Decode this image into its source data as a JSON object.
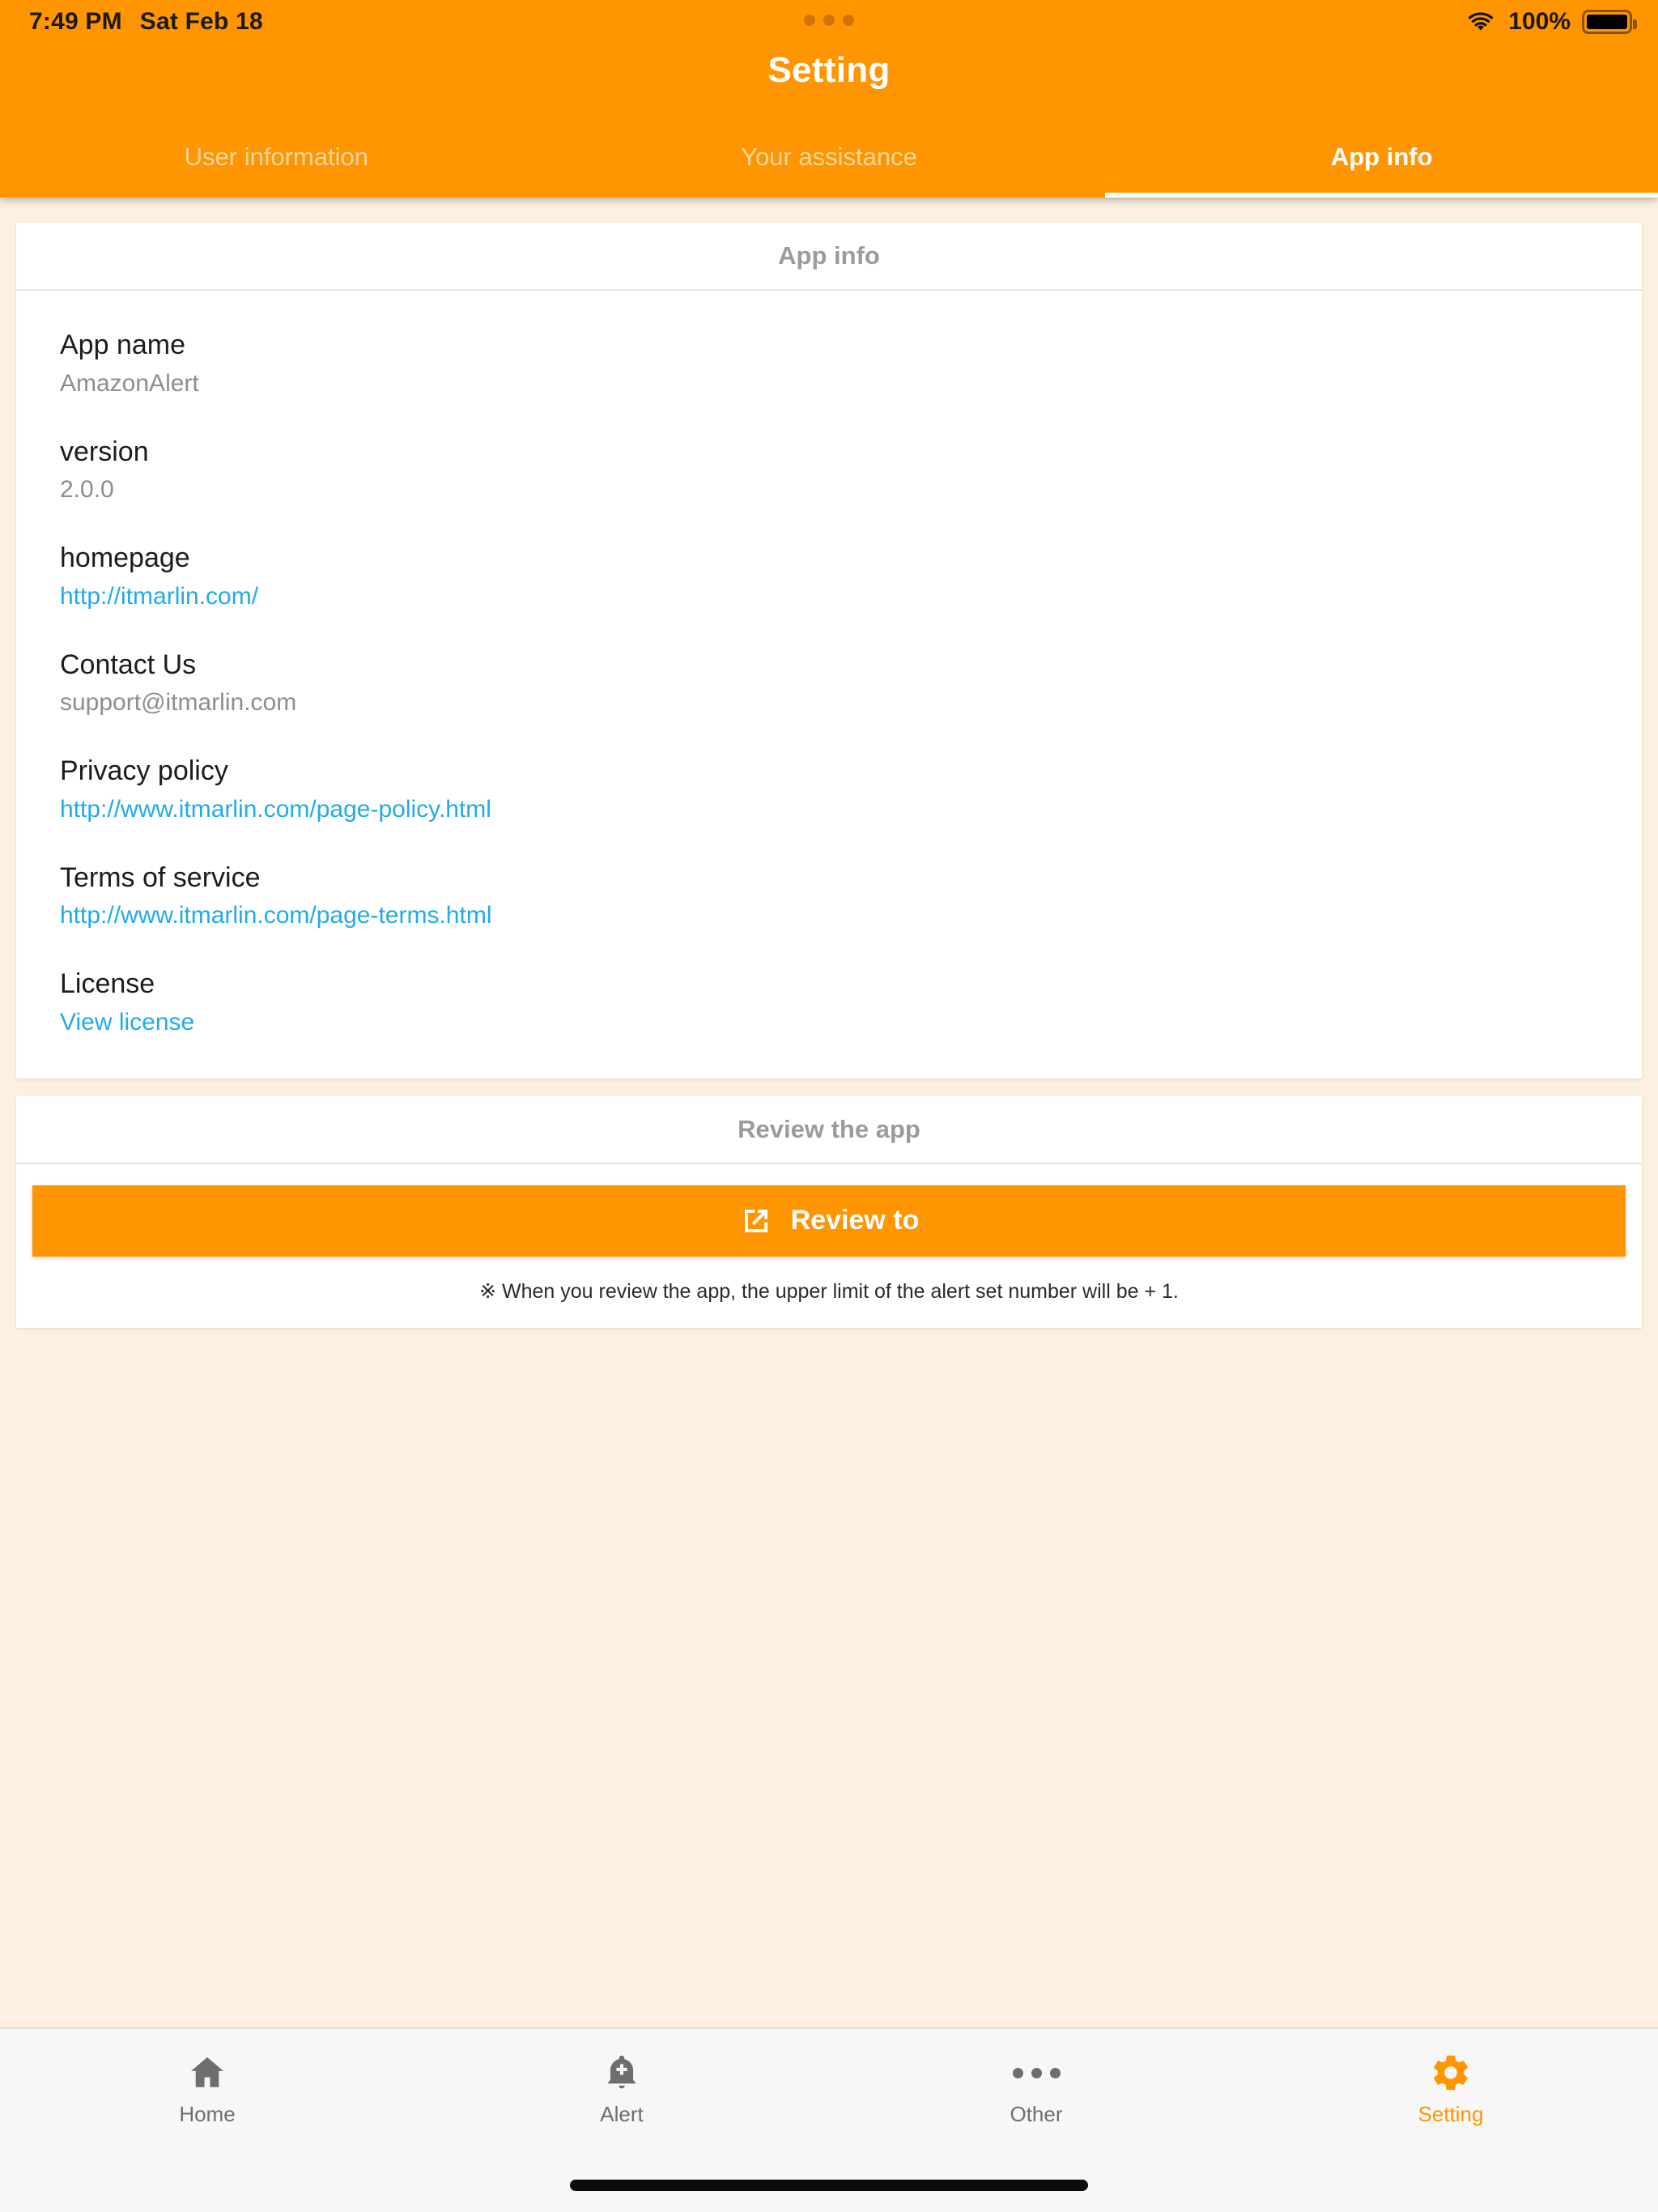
{
  "status_bar": {
    "time": "7:49 PM",
    "date": "Sat Feb 18",
    "battery_percent": "100%",
    "wifi_icon": "wifi-icon",
    "battery_icon": "battery-full-icon",
    "dots_icon": "three-dots-icon"
  },
  "header": {
    "title": "Setting",
    "accent_color": "#FF9500",
    "tabs": [
      {
        "label": "User information",
        "active": false
      },
      {
        "label": "Your assistance",
        "active": false
      },
      {
        "label": "App info",
        "active": true
      }
    ]
  },
  "app_info_card": {
    "header": "App info",
    "rows": [
      {
        "label": "App name",
        "value": "AmazonAlert",
        "is_link": false
      },
      {
        "label": "version",
        "value": "2.0.0",
        "is_link": false
      },
      {
        "label": "homepage",
        "value": "http://itmarlin.com/",
        "is_link": true
      },
      {
        "label": "Contact Us",
        "value": "support@itmarlin.com",
        "is_link": false
      },
      {
        "label": "Privacy policy",
        "value": "http://www.itmarlin.com/page-policy.html",
        "is_link": true
      },
      {
        "label": "Terms of service",
        "value": "http://www.itmarlin.com/page-terms.html",
        "is_link": true
      },
      {
        "label": "License",
        "value": "View license",
        "is_link": true
      }
    ]
  },
  "review_card": {
    "header": "Review the app",
    "button_label": "Review to",
    "button_icon": "external-link-icon",
    "button_color": "#FF9500",
    "note": "※ When you review the app, the upper limit of the alert set number will be + 1."
  },
  "bottom_bar": {
    "items": [
      {
        "label": "Home",
        "icon": "home-icon",
        "active": false
      },
      {
        "label": "Alert",
        "icon": "bell-plus-icon",
        "active": false
      },
      {
        "label": "Other",
        "icon": "three-dots-icon",
        "active": false
      },
      {
        "label": "Setting",
        "icon": "gear-icon",
        "active": true
      }
    ],
    "active_color": "#FF9500",
    "inactive_color": "#6e6e6e"
  },
  "link_color": "#22ABE6"
}
